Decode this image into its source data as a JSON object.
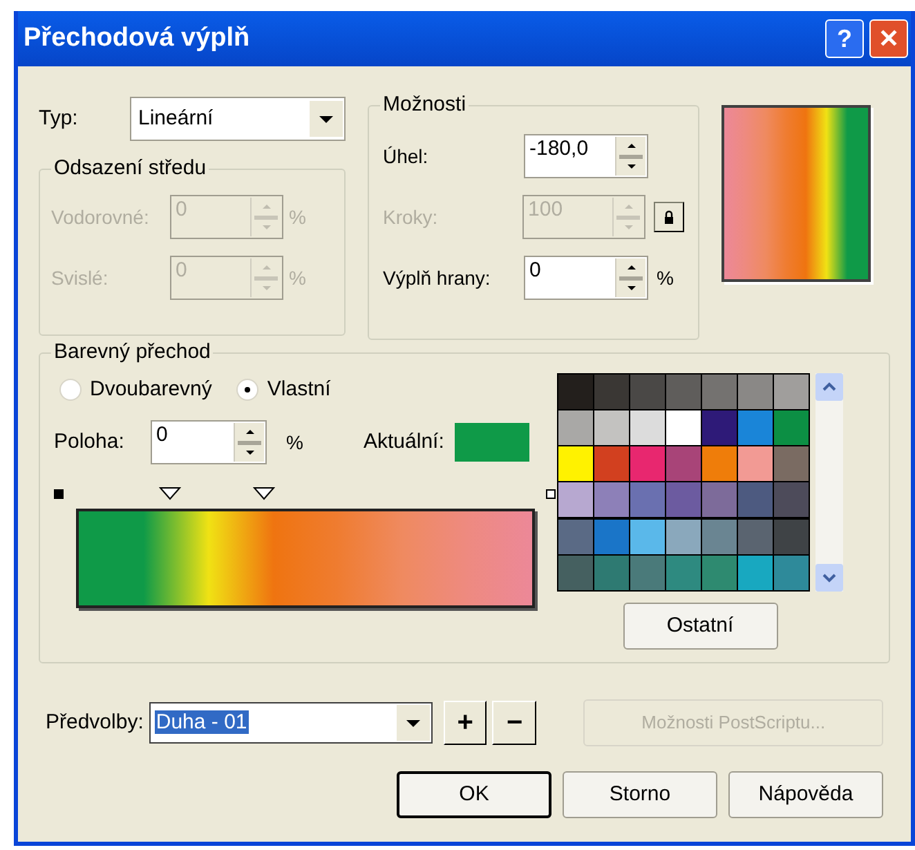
{
  "window": {
    "title": "Přechodová výplň",
    "buttons": [
      {
        "kind": "help",
        "label": "?"
      },
      {
        "kind": "close",
        "label": "✕"
      }
    ]
  },
  "type_field": {
    "label": "Typ:",
    "value": "Lineární"
  },
  "center_offset": {
    "title": "Odsazení středu",
    "fields": [
      {
        "label": "Vodorovné:",
        "value": "0",
        "unit": "%",
        "disabled": true
      },
      {
        "label": "Svislé:",
        "value": "0",
        "unit": "%",
        "disabled": true
      }
    ]
  },
  "options": {
    "title": "Možnosti",
    "fields": [
      {
        "label": "Úhel:",
        "value": "-180,0",
        "disabled": false,
        "kind": "plain"
      },
      {
        "label": "Kroky:",
        "value": "100",
        "disabled": true,
        "kind": "lock"
      },
      {
        "label": "Výplň hrany:",
        "value": "0",
        "unit": "%",
        "disabled": false,
        "kind": "plain"
      }
    ]
  },
  "color_blend": {
    "title": "Barevný přechod",
    "modes": [
      {
        "label": "Dvoubarevný",
        "selected": false
      },
      {
        "label": "Vlastní",
        "selected": true
      }
    ],
    "position": {
      "label": "Poloha:",
      "value": "0",
      "unit": "%"
    },
    "current": {
      "label": "Aktuální:",
      "color": "#0f9a48"
    },
    "stops": [
      {
        "color": "#0f9a48"
      },
      {
        "color": "#0f9a48"
      },
      {
        "color": "#f0e214"
      },
      {
        "color": "#ef7410"
      },
      {
        "color": "#ef7c30"
      },
      {
        "color": "#ef8a60"
      },
      {
        "color": "#ee8a80"
      },
      {
        "color": "#ec8898"
      }
    ],
    "markers": [
      {
        "kind": "triangle"
      },
      {
        "kind": "triangle"
      }
    ],
    "palette": [
      {
        "color": "#231f1c"
      },
      {
        "color": "#3a3734"
      },
      {
        "color": "#4a4846"
      },
      {
        "color": "#5f5d5b"
      },
      {
        "color": "#747270"
      },
      {
        "color": "#8a8886"
      },
      {
        "color": "#a09e9c"
      },
      {
        "color": "#a9a8a6"
      },
      {
        "color": "#c3c2c0"
      },
      {
        "color": "#dcdcdc"
      },
      {
        "color": "#ffffff"
      },
      {
        "color": "#2e1a78"
      },
      {
        "color": "#1a85d8"
      },
      {
        "color": "#0c8f44"
      },
      {
        "color": "#fff200"
      },
      {
        "color": "#d2401f"
      },
      {
        "color": "#e8276f"
      },
      {
        "color": "#a84478"
      },
      {
        "color": "#ef7d0a"
      },
      {
        "color": "#f29a94"
      },
      {
        "color": "#7a6b62"
      },
      {
        "color": "#b7a8d0"
      },
      {
        "color": "#8d80b8"
      },
      {
        "color": "#6a70b0"
      },
      {
        "color": "#6c5ba0"
      },
      {
        "color": "#7d6b9a"
      },
      {
        "color": "#4d5a80"
      },
      {
        "color": "#4d4b5a"
      },
      {
        "color": "#5a6a85"
      },
      {
        "color": "#1a75c8"
      },
      {
        "color": "#5ab8ea"
      },
      {
        "color": "#8aa8bc"
      },
      {
        "color": "#6a8592"
      },
      {
        "color": "#5a6470"
      },
      {
        "color": "#3f4346"
      },
      {
        "color": "#456060"
      },
      {
        "color": "#2e7a72"
      },
      {
        "color": "#4a7a7a"
      },
      {
        "color": "#2e8a80"
      },
      {
        "color": "#2e8a70"
      },
      {
        "color": "#18a8c0"
      },
      {
        "color": "#2e8a9a"
      }
    ],
    "other_button": "Ostatní"
  },
  "presets": {
    "label": "Předvolby:",
    "value": "Duha - 01",
    "add": "+",
    "remove": "−"
  },
  "postscript_button": {
    "label": "Možnosti PostScriptu...",
    "disabled": true
  },
  "buttons": [
    {
      "label": "OK",
      "default": true
    },
    {
      "label": "Storno",
      "default": false
    },
    {
      "label": "Nápověda",
      "default": false
    }
  ]
}
